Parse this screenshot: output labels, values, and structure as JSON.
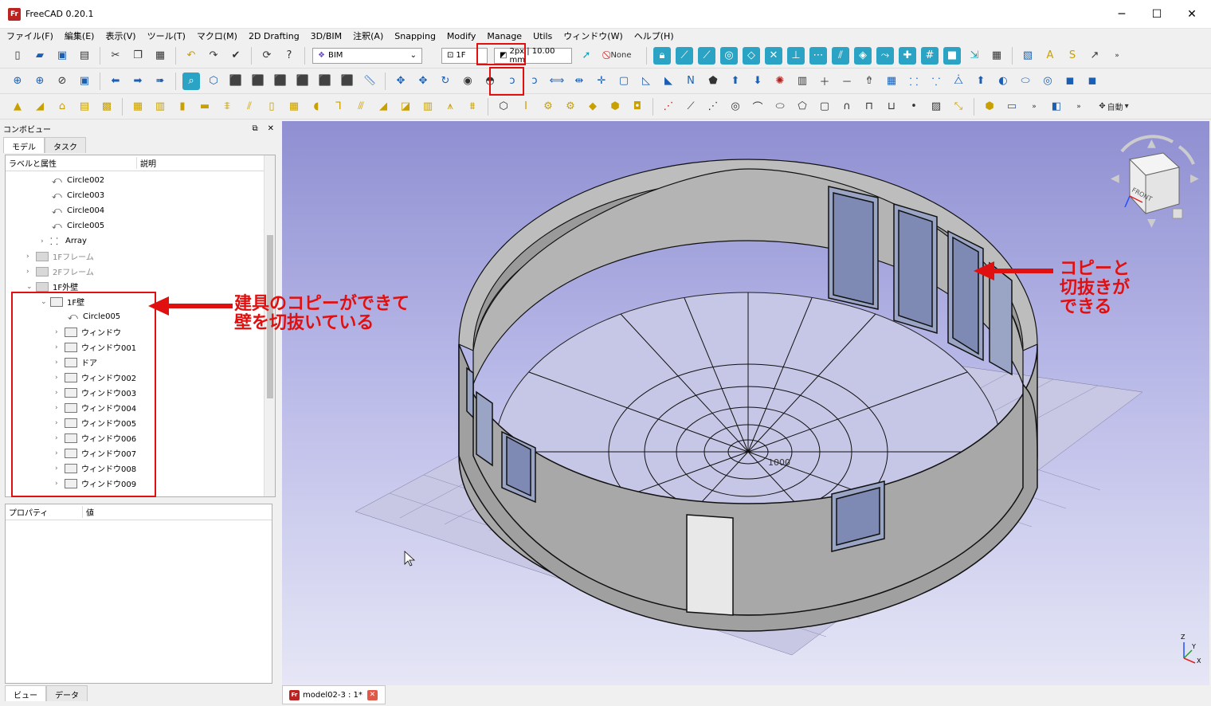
{
  "window": {
    "title": "FreeCAD 0.20.1",
    "minimize": "─",
    "maximize": "☐",
    "close": "✕"
  },
  "menu": [
    "ファイル(F)",
    "編集(E)",
    "表示(V)",
    "ツール(T)",
    "マクロ(M)",
    "2D Drafting",
    "3D/BIM",
    "注釈(A)",
    "Snapping",
    "Modify",
    "Manage",
    "Utils",
    "ウィンドウ(W)",
    "ヘルプ(H)"
  ],
  "toolbar": {
    "workbench": "BIM",
    "working_plane": "1F",
    "line_style": "2px | 10.00 mm",
    "none_label": "None",
    "auto_label": "自動"
  },
  "left_panel": {
    "title": "コンボビュー",
    "tabs": [
      "モデル",
      "タスク"
    ],
    "tree_columns": [
      "ラベルと属性",
      "説明"
    ],
    "tree_items": [
      {
        "label": "Circle002"
      },
      {
        "label": "Circle003"
      },
      {
        "label": "Circle004"
      },
      {
        "label": "Circle005"
      },
      {
        "label": "Array"
      },
      {
        "label": "1Fフレーム"
      },
      {
        "label": "2Fフレーム"
      },
      {
        "label": "1F外壁"
      },
      {
        "label": "1F壁"
      },
      {
        "label": "Circle005"
      },
      {
        "label": "ウィンドウ"
      },
      {
        "label": "ウィンドウ001"
      },
      {
        "label": "ドア"
      },
      {
        "label": "ウィンドウ002"
      },
      {
        "label": "ウィンドウ003"
      },
      {
        "label": "ウィンドウ004"
      },
      {
        "label": "ウィンドウ005"
      },
      {
        "label": "ウィンドウ006"
      },
      {
        "label": "ウィンドウ007"
      },
      {
        "label": "ウィンドウ008"
      },
      {
        "label": "ウィンドウ009"
      }
    ],
    "property_columns": [
      "プロパティ",
      "値"
    ],
    "bottom_tabs": [
      "ビュー",
      "データ"
    ]
  },
  "viewport": {
    "document_tab": "model02-3 : 1*",
    "navcube_face": "FRONT",
    "axes": [
      "Z",
      "Y",
      "X"
    ],
    "grid_label": "1000"
  },
  "annotations": {
    "left_line1": "建具のコピーができて",
    "left_line2": "壁を切抜いている",
    "right_line1": "コピーと",
    "right_line2": "切抜きが",
    "right_line3": "できる",
    "color": "#e01010"
  }
}
